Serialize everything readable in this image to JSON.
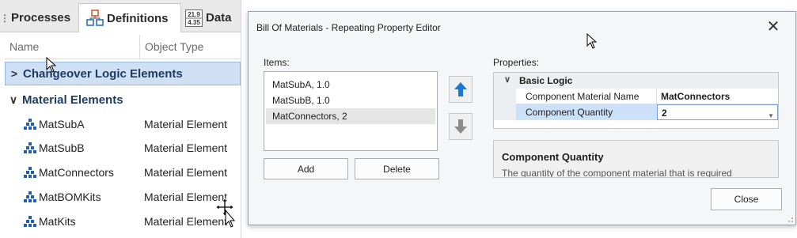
{
  "left_panel": {
    "tabs": [
      {
        "label": "Processes",
        "icon": "processes-icon"
      },
      {
        "label": "Definitions",
        "icon": "definitions-icon"
      },
      {
        "label": "Data",
        "icon": "data-table-icon",
        "icon_text_top": "21.9",
        "icon_text_bottom": "4.35"
      }
    ],
    "columns": [
      "Name",
      "Object Type"
    ],
    "groups": [
      {
        "label": "Changeover Logic Elements",
        "expanded": false,
        "chevron": ">"
      },
      {
        "label": "Material Elements",
        "expanded": true,
        "chevron": "∨"
      }
    ],
    "items": [
      {
        "name": "MatSubA",
        "type": "Material Element"
      },
      {
        "name": "MatSubB",
        "type": "Material Element"
      },
      {
        "name": "MatConnectors",
        "type": "Material Element"
      },
      {
        "name": "MatBOMKits",
        "type": "Material Element"
      },
      {
        "name": "MatKits",
        "type": "Material Element"
      }
    ]
  },
  "dialog": {
    "title": "Bill Of Materials - Repeating Property Editor",
    "close_glyph": "✕",
    "items_label": "Items:",
    "items": [
      "MatSubA, 1.0",
      "MatSubB, 1.0",
      "MatConnectors, 2"
    ],
    "add_label": "Add",
    "delete_label": "Delete",
    "properties_label": "Properties:",
    "category": "Basic Logic",
    "properties": [
      {
        "name": "Component Material Name",
        "value": "MatConnectors"
      },
      {
        "name": "Component Quantity",
        "value": "2"
      }
    ],
    "description_title": "Component Quantity",
    "description_text": "The quantity of the component material that is required",
    "close_button": "Close"
  },
  "colors": {
    "selection_blue": "#cfe0f5",
    "arrow_up_blue": "#1e78d2",
    "arrow_down_gray": "#8c8c8c",
    "material_icon_blue": "#1e5fb4"
  }
}
